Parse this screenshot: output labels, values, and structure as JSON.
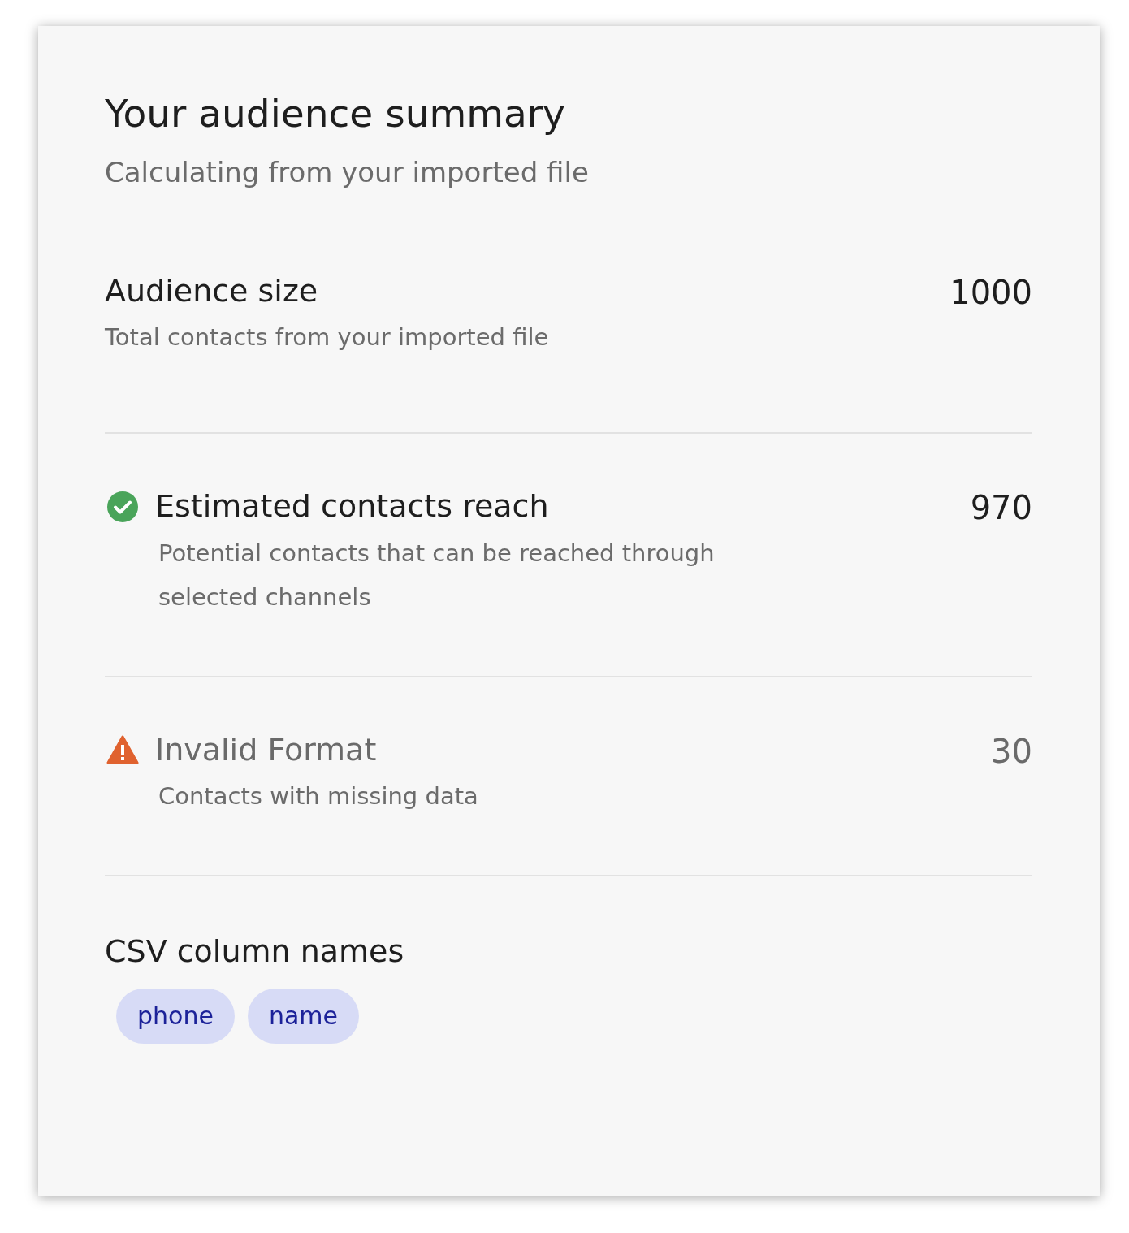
{
  "title": "Your audience summary",
  "subtitle": "Calculating from your imported file",
  "metrics": [
    {
      "kind": "plain",
      "title": "Audience size",
      "description": "Total contacts from your imported file",
      "value": "1000"
    },
    {
      "kind": "success",
      "title": "Estimated contacts reach",
      "description": "Potential contacts that can be reached through selected channels",
      "value": "970"
    },
    {
      "kind": "warning",
      "title": "Invalid Format",
      "description": "Contacts with missing data",
      "value": "30"
    }
  ],
  "columns": {
    "title": "CSV column names",
    "tags": [
      "phone",
      "name"
    ]
  }
}
